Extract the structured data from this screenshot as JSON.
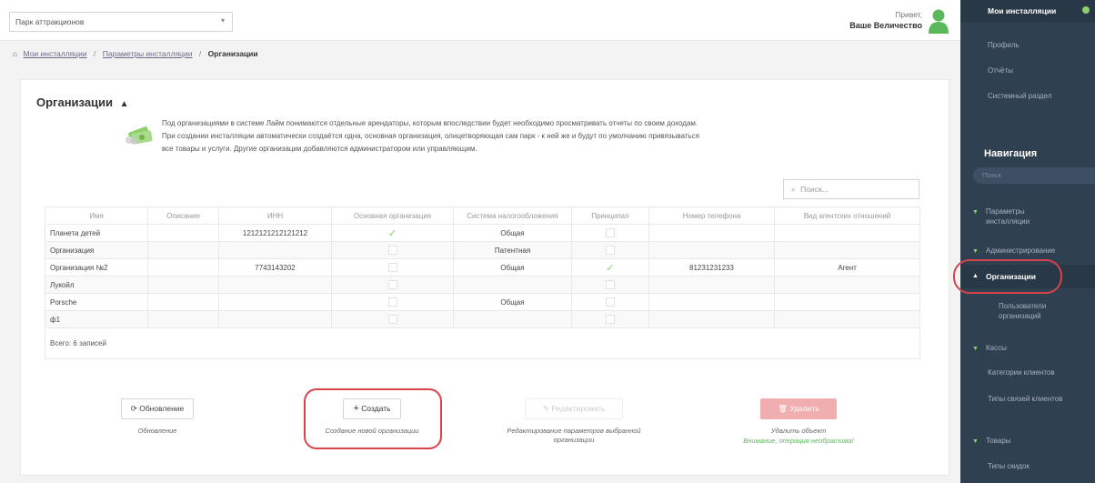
{
  "topbar": {
    "park_select": "Парк аттракционов",
    "greeting": "Привет,",
    "user_name": "Ваше Величество"
  },
  "breadcrumb": {
    "items": [
      "Мои инсталляции",
      "Параметры инсталляции"
    ],
    "current": "Организации"
  },
  "panel": {
    "title": "Организации",
    "description": [
      "Под организациями в системе Лайм понимаются отдельные арендаторы, которым впоследствии будет необходимо просматривать отчеты по своим доходам.",
      "При создании инсталляции автоматически создаётся одна, основная организация, олицетворяющая сам парк - к ней же и будут по умолчанию привязываться",
      "все товары и услуги. Другие организации добавляются администратором или управляющим."
    ],
    "search_placeholder": "Поиск...",
    "columns": [
      "Имя",
      "Описание",
      "ИНН",
      "Основная организация",
      "Система налогообложения",
      "Принципал",
      "Номер телефона",
      "Вид агентских отношений"
    ],
    "rows": [
      {
        "name": "Планета детей",
        "desc": "",
        "inn": "1212121212121212",
        "main": true,
        "tax": "Общая",
        "principal": false,
        "phone": "",
        "agent": ""
      },
      {
        "name": "Организация",
        "desc": "",
        "inn": "",
        "main": false,
        "tax": "Патентная",
        "principal": false,
        "phone": "",
        "agent": ""
      },
      {
        "name": "Организация №2",
        "desc": "",
        "inn": "7743143202",
        "main": false,
        "tax": "Общая",
        "principal": true,
        "phone": "81231231233",
        "agent": "Агент"
      },
      {
        "name": "Лукойл",
        "desc": "",
        "inn": "",
        "main": false,
        "tax": "",
        "principal": false,
        "phone": "",
        "agent": ""
      },
      {
        "name": "Porsche",
        "desc": "",
        "inn": "",
        "main": false,
        "tax": "Общая",
        "principal": false,
        "phone": "",
        "agent": ""
      },
      {
        "name": "ф1",
        "desc": "",
        "inn": "",
        "main": false,
        "tax": "",
        "principal": false,
        "phone": "",
        "agent": ""
      }
    ],
    "total": "Всего: 6 записей"
  },
  "buttons": {
    "refresh": {
      "label": "Обновление",
      "caption": "Обновление"
    },
    "create": {
      "label": "Создать",
      "caption": "Создание новой организации"
    },
    "edit": {
      "label": "Редактировать",
      "caption": "Редактирование параметров выбранной организации"
    },
    "delete": {
      "label": "Удалить",
      "caption": "Удалить объект",
      "warning": "Внимание, операция необратима!"
    }
  },
  "sidebar": {
    "top_active": "Мои инсталляции",
    "top_items": [
      "Профиль",
      "Отчёты",
      "Системный раздел"
    ],
    "nav_title": "Навигация",
    "search_placeholder": "Поиск",
    "groups": {
      "params": "Параметры инсталляции",
      "admin": "Администрирование",
      "orgs": "Организации",
      "org_users": "Пользователи организаций",
      "cash": "Кассы",
      "client_cat": "Категории клиентов",
      "link_types": "Типы связей клиентов",
      "goods": "Товары",
      "discount_types": "Типы скидок"
    }
  },
  "colors": {
    "sidebar_bg": "#2f4050",
    "accent_green": "#8ccf6c",
    "annotation_red": "#d9434a"
  }
}
